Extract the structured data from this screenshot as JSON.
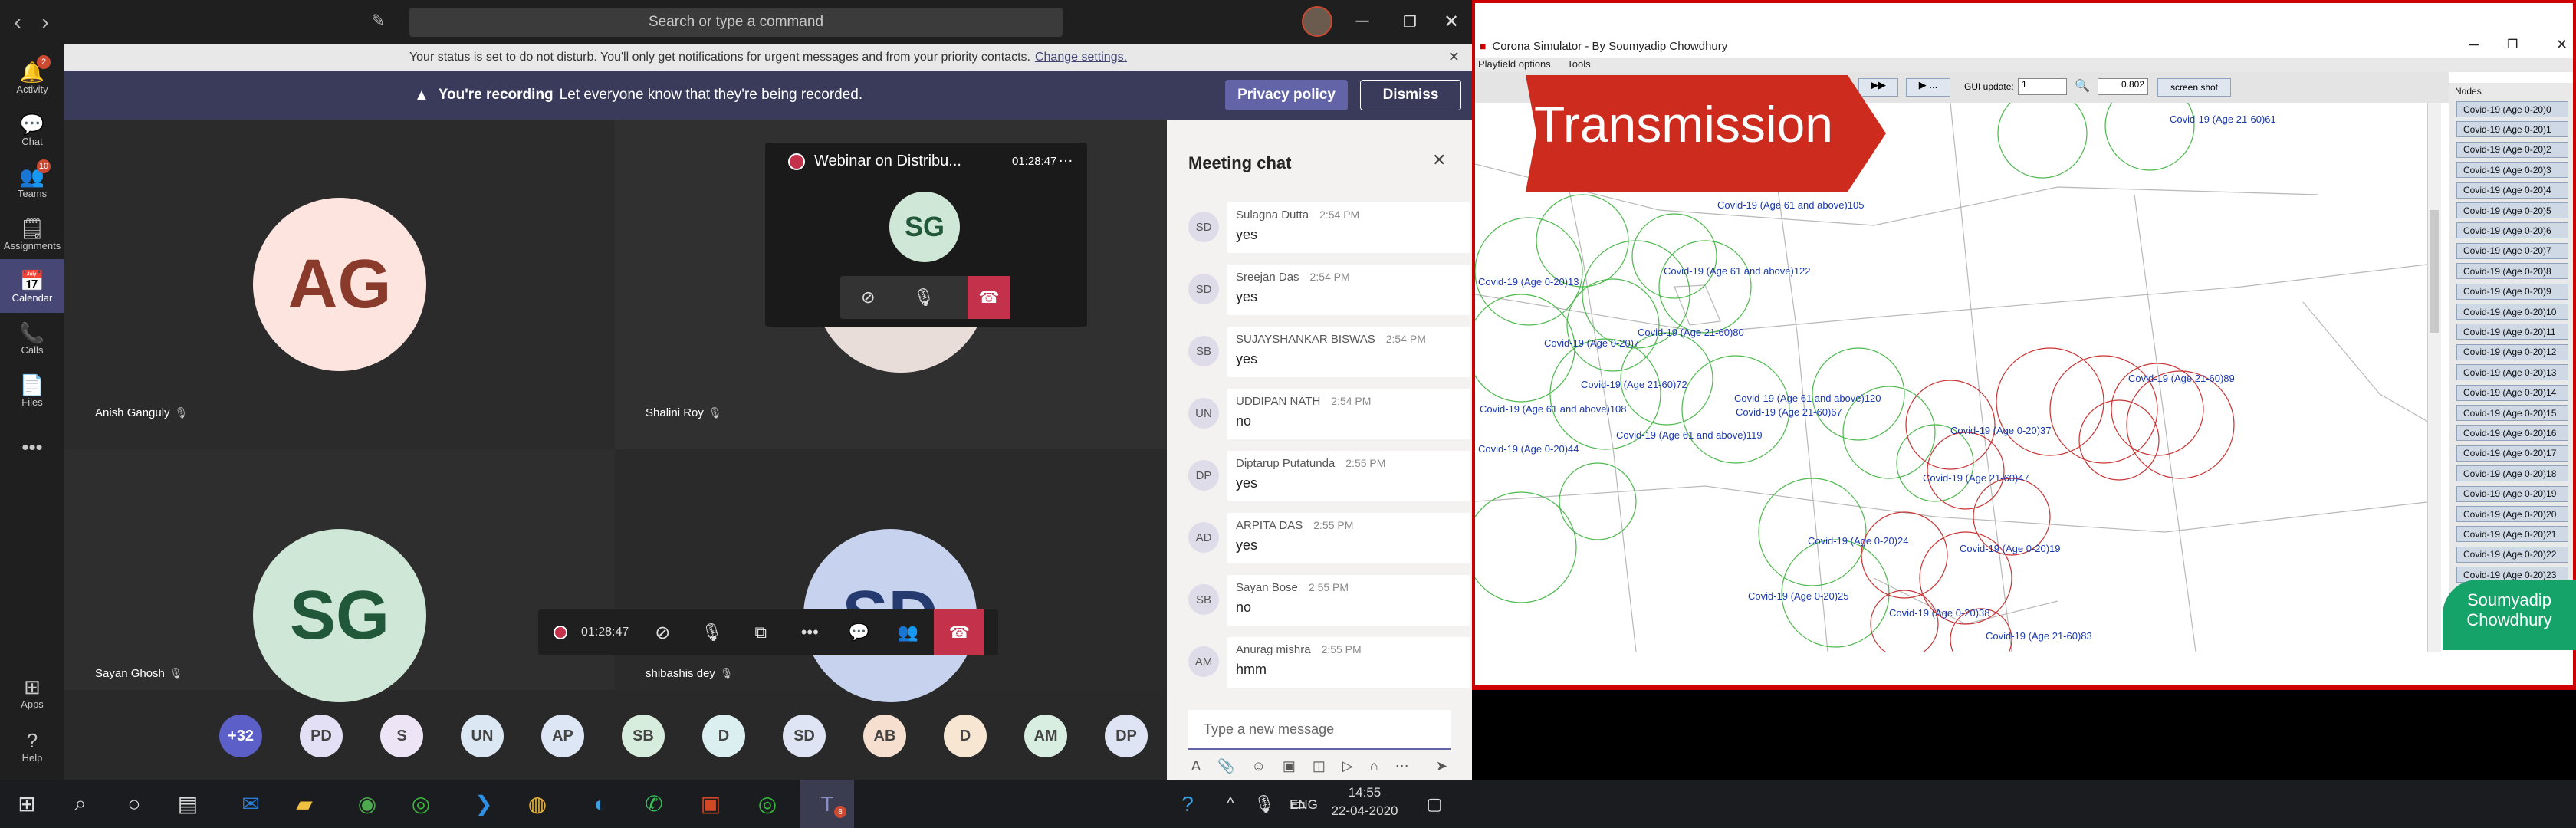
{
  "teams": {
    "search_placeholder": "Search or type a command",
    "dnd_notice": "Your status is set to do not disturb. You'll only get notifications for urgent messages and from your priority contacts.",
    "dnd_link": "Change settings.",
    "recording_bold": "You're recording",
    "recording_text": "Let everyone know that they're being recorded.",
    "privacy_button": "Privacy policy",
    "dismiss_button": "Dismiss",
    "app_bar": [
      {
        "label": "Activity",
        "icon": "bell-icon",
        "badge": "2"
      },
      {
        "label": "Chat",
        "icon": "chat-icon",
        "badge": ""
      },
      {
        "label": "Teams",
        "icon": "teams-icon",
        "badge": "10"
      },
      {
        "label": "Assignments",
        "icon": "assignments-icon",
        "badge": ""
      },
      {
        "label": "Calendar",
        "icon": "calendar-icon",
        "badge": ""
      },
      {
        "label": "Calls",
        "icon": "phone-icon",
        "badge": ""
      },
      {
        "label": "Files",
        "icon": "files-icon",
        "badge": ""
      },
      {
        "label": "Apps",
        "icon": "apps-icon",
        "badge": ""
      },
      {
        "label": "Help",
        "icon": "help-icon",
        "badge": ""
      }
    ],
    "participants": [
      {
        "initials": "AG",
        "name": "Anish Ganguly"
      },
      {
        "initials": "",
        "name": "Shalini Roy"
      },
      {
        "initials": "SG",
        "name": "Sayan Ghosh"
      },
      {
        "initials": "SD",
        "name": "shibashis dey"
      }
    ],
    "pip": {
      "title": "Webinar on Distribu...",
      "timer": "01:28:47",
      "initials": "SG"
    },
    "controls": {
      "timer": "01:28:47"
    },
    "roster": [
      "+32",
      "PD",
      "S",
      "UN",
      "AP",
      "SB",
      "D",
      "SD",
      "AB",
      "D",
      "AM",
      "DP"
    ],
    "chat": {
      "title": "Meeting chat",
      "input_placeholder": "Type a new message",
      "messages": [
        {
          "initials": "SD",
          "name": "Sulagna Dutta",
          "time": "2:54 PM",
          "text": "yes"
        },
        {
          "initials": "SD",
          "name": "Sreejan Das",
          "time": "2:54 PM",
          "text": "yes"
        },
        {
          "initials": "SB",
          "name": "SUJAYSHANKAR BISWAS",
          "time": "2:54 PM",
          "text": "yes"
        },
        {
          "initials": "UN",
          "name": "UDDIPAN NATH",
          "time": "2:54 PM",
          "text": "no"
        },
        {
          "initials": "DP",
          "name": "Diptarup Putatunda",
          "time": "2:55 PM",
          "text": "yes"
        },
        {
          "initials": "AD",
          "name": "ARPITA DAS",
          "time": "2:55 PM",
          "text": "yes"
        },
        {
          "initials": "SB",
          "name": "Sayan Bose",
          "time": "2:55 PM",
          "text": "no"
        },
        {
          "initials": "AM",
          "name": "Anurag mishra",
          "time": "2:55 PM",
          "text": "hmm"
        }
      ]
    }
  },
  "simulator": {
    "title": "Corona Simulator - By Soumyadip Chowdhury",
    "menu": [
      "Playfield options",
      "Tools"
    ],
    "gui_update_label": "GUI update:",
    "gui_update_value": "1",
    "zoom_value": "0.802",
    "screenshot_button": "screen shot",
    "nodes_header": "Nodes",
    "banner": "Transmission",
    "watermark": "Soumyadip Chowdhury",
    "nodes": [
      "Covid-19 (Age 0-20)0",
      "Covid-19 (Age 0-20)1",
      "Covid-19 (Age 0-20)2",
      "Covid-19 (Age 0-20)3",
      "Covid-19 (Age 0-20)4",
      "Covid-19 (Age 0-20)5",
      "Covid-19 (Age 0-20)6",
      "Covid-19 (Age 0-20)7",
      "Covid-19 (Age 0-20)8",
      "Covid-19 (Age 0-20)9",
      "Covid-19 (Age 0-20)10",
      "Covid-19 (Age 0-20)11",
      "Covid-19 (Age 0-20)12",
      "Covid-19 (Age 0-20)13",
      "Covid-19 (Age 0-20)14",
      "Covid-19 (Age 0-20)15",
      "Covid-19 (Age 0-20)16",
      "Covid-19 (Age 0-20)17",
      "Covid-19 (Age 0-20)18",
      "Covid-19 (Age 0-20)19",
      "Covid-19 (Age 0-20)20",
      "Covid-19 (Age 0-20)21",
      "Covid-19 (Age 0-20)22",
      "Covid-19 (Age 0-20)23",
      "Covid-19 (Age 0-20)24"
    ],
    "field_labels": [
      "Covid-19 (Age 21-60)61",
      "Covid-19 (Age 61 and above)105",
      "Covid-19 (Age 61 and above)122",
      "Covid-19 (Age 0-20)13",
      "Covid-19 (Age 21-60)80",
      "Covid-19 (Age 0-20)7",
      "Covid-19 (Age 21-60)72",
      "Covid-19 (Age 61 and above)120",
      "Covid-19 (Age 21-60)67",
      "Covid-19 (Age 61 and above)119",
      "Covid-19 (Age 0-20)37",
      "Covid-19 (Age 21-60)47",
      "Covid-19 (Age 0-20)24",
      "Covid-19 (Age 0-20)19",
      "Covid-19 (Age 0-20)25",
      "Covid-19 (Age 0-20)38",
      "Covid-19 (Age 21-60)83",
      "Covid-19 (Age 21-60)89",
      "Covid-19 (Age 0-20)44",
      "Covid-19 (Age 61 and above)108"
    ]
  },
  "taskbar": {
    "time": "14:55",
    "date": "22-04-2020",
    "lang": "ENG",
    "teams_badge": "8"
  }
}
